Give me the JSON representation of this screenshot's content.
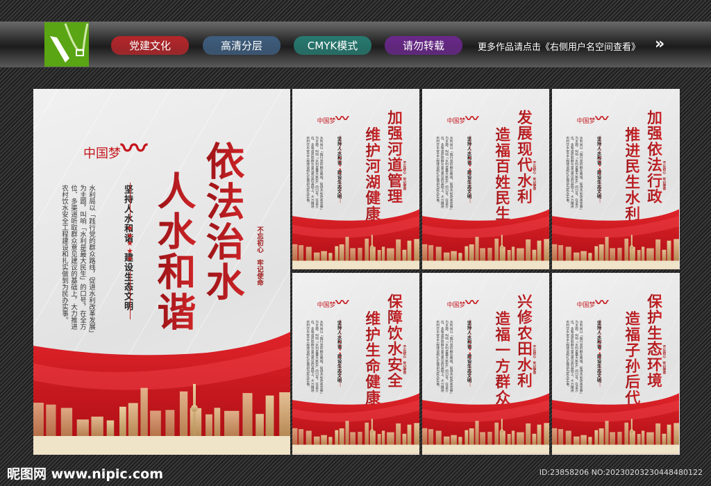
{
  "header": {
    "buttons": [
      {
        "label": "党建文化",
        "color": "#b3262a"
      },
      {
        "label": "高清分层",
        "color": "#3e5d7e"
      },
      {
        "label": "CMYK模式",
        "color": "#267a70"
      },
      {
        "label": "请勿转载",
        "color": "#69288a"
      }
    ],
    "more_text": "更多作品请点击《右侧用户名空间查看》",
    "arrow": "»"
  },
  "common": {
    "logo_text": "中国梦",
    "subtitle": "坚持人水和谐　建设生态文明",
    "body": "水利局以「践行党的群众路线，促进水利改革发展」为主题，叫响「水利是最大民生」的口号，在全方位、多渠道听取群众意见建议的基础上，大力推进农村饮水安全工程建设和扎实做到为民办实事。",
    "seal": "不忘初心　牢记使命",
    "stars": "★★★★★"
  },
  "posters": [
    {
      "line1": "依法治水",
      "line2": "人水和谐"
    },
    {
      "line1": "加强河道管理",
      "line2": "维护河湖健康"
    },
    {
      "line1": "发展现代水利",
      "line2": "造福百姓民生"
    },
    {
      "line1": "加强依法行政",
      "line2": "推进民生水利"
    },
    {
      "line1": "保障饮水安全",
      "line2": "维护生命健康"
    },
    {
      "line1": "兴修农田水利",
      "line2": "造福一方群众"
    },
    {
      "line1": "保护生态环境",
      "line2": "造福子孙后代"
    }
  ],
  "footer": {
    "site": "昵图网 www.nipic.com",
    "id": "ID:23858206 NO:20230203230448480122"
  }
}
